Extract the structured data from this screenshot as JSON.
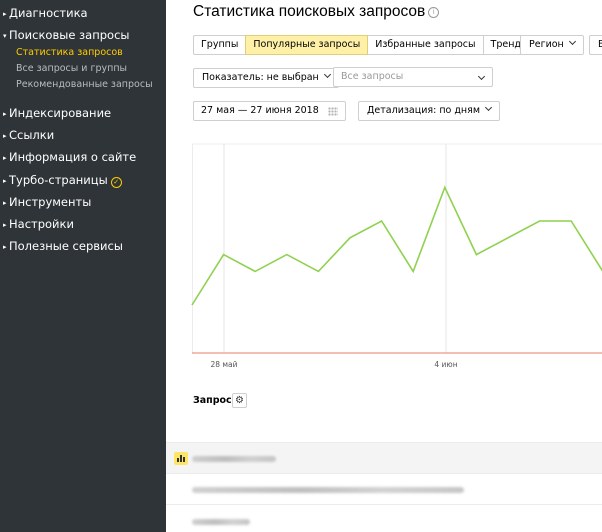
{
  "sidebar": {
    "items": [
      {
        "label": "Диагностика"
      },
      {
        "label": "Поисковые запросы"
      },
      {
        "label": "Индексирование"
      },
      {
        "label": "Ссылки"
      },
      {
        "label": "Информация о сайте"
      },
      {
        "label": "Турбо-страницы"
      },
      {
        "label": "Инструменты"
      },
      {
        "label": "Настройки"
      },
      {
        "label": "Полезные сервисы"
      }
    ],
    "subitems": [
      {
        "label": "Статистика запросов",
        "active": true
      },
      {
        "label": "Все запросы и группы",
        "active": false
      },
      {
        "label": "Рекомендованные запросы",
        "active": false
      }
    ],
    "turbo_badge_icon": "rocket-badge-icon",
    "colors": {
      "background": "#2f3438",
      "active_subitem": "#ffcc00"
    }
  },
  "header": {
    "title": "Статистика поисковых запросов",
    "info_icon": "info-icon"
  },
  "tabs": [
    {
      "label": "Группы",
      "active": false
    },
    {
      "label": "Популярные запросы",
      "active": true
    },
    {
      "label": "Избранные запросы",
      "active": false
    },
    {
      "label": "Тренд",
      "active": false
    }
  ],
  "filters": {
    "region_label": "Регион",
    "extra_label": "В",
    "indicator_label": "Показатель: не выбран",
    "queries_placeholder": "Все запросы",
    "date_range": "27 мая — 27 июня 2018",
    "detail_label": "Детализация: по дням"
  },
  "chart_data": {
    "type": "line",
    "x_ticks": [
      "28 май",
      "4 июн"
    ],
    "series": [
      {
        "values": [
          0.25,
          0.55,
          0.45,
          0.55,
          0.45,
          0.65,
          0.75,
          0.45,
          0.95,
          0.55,
          0.65,
          0.75,
          0.75,
          0.45
        ]
      }
    ],
    "line_color": "#8fd14f",
    "baseline_color": "#e87d6a",
    "grid": true
  },
  "table": {
    "header": "Запрос",
    "settings_icon": "gear-icon",
    "chart_toggle_icon": "bar-chart-icon"
  }
}
